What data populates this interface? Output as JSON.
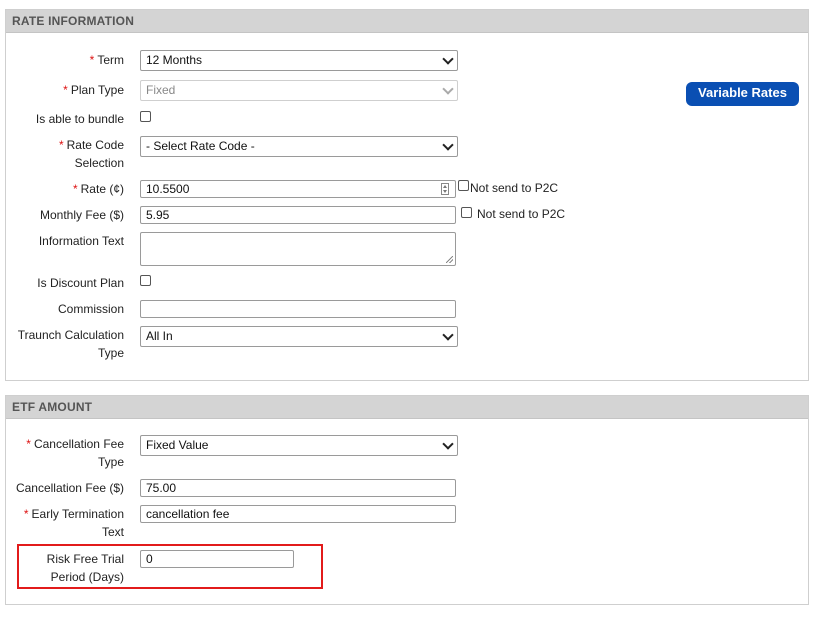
{
  "rate_info": {
    "title": "RATE INFORMATION",
    "term": {
      "label": "Term",
      "value": "12 Months"
    },
    "plan_type": {
      "label": "Plan Type",
      "value": "Fixed"
    },
    "bundle": {
      "label": "Is able to bundle"
    },
    "rate_code": {
      "label_line1": "Rate Code",
      "label_line2": "Selection",
      "value": "- Select Rate Code -"
    },
    "rate": {
      "label": "Rate (¢)",
      "value": "10.5500",
      "checkbox_label": "Not send to P2C"
    },
    "monthly_fee": {
      "label": "Monthly Fee ($)",
      "value": "5.95",
      "checkbox_label": "Not send to P2C"
    },
    "info_text": {
      "label": "Information Text",
      "value": ""
    },
    "discount": {
      "label": "Is Discount Plan"
    },
    "commission": {
      "label": "Commission",
      "value": ""
    },
    "traunch": {
      "label_line1": "Traunch Calculation",
      "label_line2": "Type",
      "value": "All In"
    },
    "variable_rates_button": "Variable Rates"
  },
  "etf": {
    "title": "ETF AMOUNT",
    "cancel_type": {
      "label_line1": "Cancellation Fee",
      "label_line2": "Type",
      "value": "Fixed Value"
    },
    "cancel_fee": {
      "label": "Cancellation Fee ($)",
      "value": "75.00"
    },
    "early_term": {
      "label_line1": "Early Termination",
      "label_line2": "Text",
      "value": "cancellation fee"
    },
    "risk_free": {
      "label_line1": "Risk Free Trial",
      "label_line2": "Period (Days)",
      "value": "0"
    }
  },
  "colors": {
    "accent": "#0a4fb3",
    "required": "#dd1111",
    "highlight": "#e21b1b"
  }
}
